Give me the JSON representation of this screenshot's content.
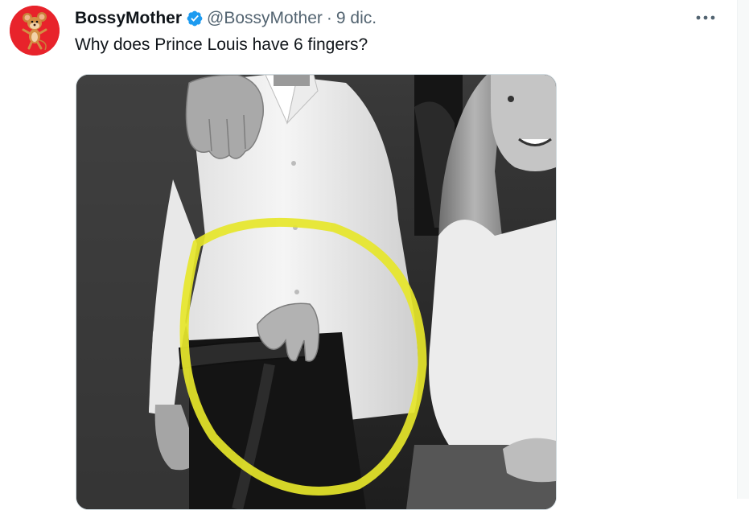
{
  "tweet": {
    "display_name": "BossyMother",
    "handle": "@BossyMother",
    "separator": "·",
    "date": "9 dic.",
    "text": "Why does Prince Louis have 6 fingers?",
    "more_label": "•••"
  },
  "colors": {
    "verified": "#1d9bf0",
    "avatar_bg": "#e8232b",
    "highlight_circle": "#e6e62a",
    "secondary_text": "#536471"
  },
  "icons": {
    "verified": "verified-badge-icon",
    "more": "more-options-icon"
  }
}
